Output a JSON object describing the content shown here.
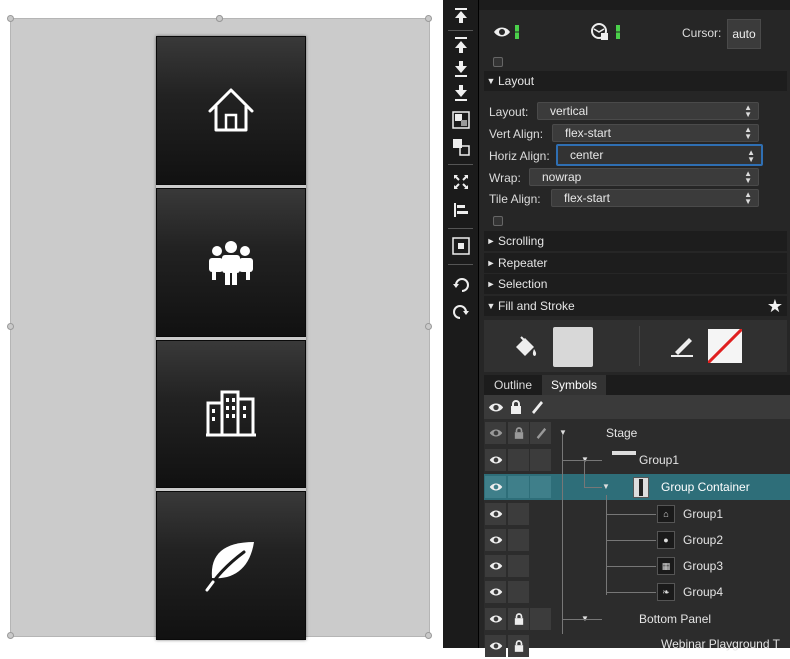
{
  "canvas": {
    "tiles": [
      {
        "icon": "home-icon"
      },
      {
        "icon": "people-group-icon"
      },
      {
        "icon": "city-buildings-icon"
      },
      {
        "icon": "leaf-icon"
      }
    ]
  },
  "toolbar": {
    "tools": [
      "bring-to-front-icon",
      "bring-forward-icon",
      "send-backward-icon",
      "send-to-back-icon",
      "group-icon",
      "ungroup-icon",
      "fit-icon",
      "align-left-icon",
      "frame-icon",
      "undo-icon",
      "redo-icon"
    ]
  },
  "properties": {
    "cursor_label": "Cursor:",
    "cursor_value": "auto",
    "layout_section": "Layout",
    "fields": [
      {
        "label": "Layout:",
        "value": "vertical"
      },
      {
        "label": "Vert Align:",
        "value": "flex-start"
      },
      {
        "label": "Horiz Align:",
        "value": "center"
      },
      {
        "label": "Wrap:",
        "value": "nowrap"
      },
      {
        "label": "Tile Align:",
        "value": "flex-start"
      }
    ],
    "collapsed_sections": [
      "Scrolling",
      "Repeater",
      "Selection"
    ],
    "fill_stroke_section": "Fill and Stroke",
    "fill_color": "#d8d8d8",
    "stroke_none_color": "#e02020"
  },
  "outline": {
    "tabs": [
      "Outline",
      "Symbols"
    ],
    "active_tab": "Symbols",
    "items": [
      {
        "label": "Stage"
      },
      {
        "label": "Group1"
      },
      {
        "label": "Group Container"
      },
      {
        "label": "Group1"
      },
      {
        "label": "Group2"
      },
      {
        "label": "Group3"
      },
      {
        "label": "Group4"
      },
      {
        "label": "Bottom Panel"
      },
      {
        "label": "Webinar Playground T"
      }
    ],
    "selected_color": "#2e6e79"
  }
}
